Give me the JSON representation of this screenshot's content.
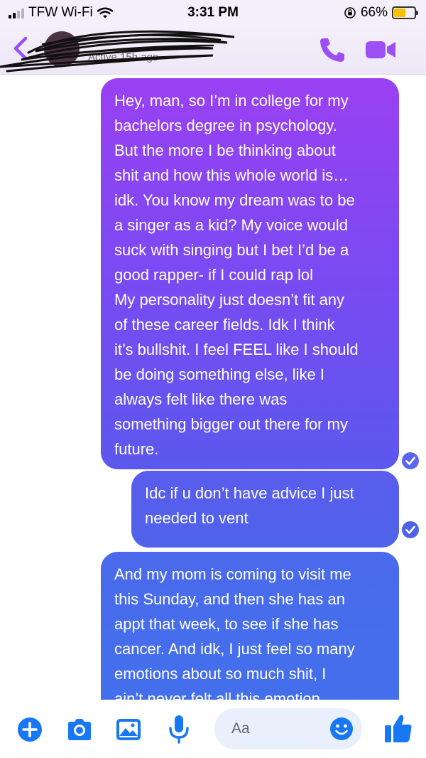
{
  "status_bar": {
    "carrier": "TFW Wi-Fi",
    "time": "3:31 PM",
    "battery_percent": "66%",
    "battery_level": 0.66,
    "signal_bars": 2
  },
  "header": {
    "contact_name": "",
    "active_status": "Active 15h ago",
    "icons": {
      "back": "chevron-left-icon",
      "call": "phone-icon",
      "video": "video-camera-icon"
    },
    "accent_color": "#9b4ff5"
  },
  "messages": [
    {
      "sender": "me",
      "text": "Hey, man, so I’m in college for my\nbachelors degree in psychology.\nBut the more I be thinking about\nshit and how this whole world is…\nidk. You know my dream was to be\na singer as a kid? My voice would\nsuck with singing but I bet I’d be a\ngood rapper- if I could rap lol\nMy personality just doesn’t fit any\nof these career fields. Idk I think\nit’s bullshit. I feel FEEL like I should\nbe doing something else, like I\nalways felt like there was\nsomething bigger out there for my\nfuture."
    },
    {
      "sender": "me",
      "text": "Idc if u don’t have advice I just\nneeded to vent"
    },
    {
      "sender": "me",
      "text": "And my mom is coming to visit me\nthis Sunday, and then she has an\nappt that week, to see if she has\ncancer. And idk, I just feel so many\nemotions about so much shit, I\nain’t never felt all this emotion"
    }
  ],
  "composer": {
    "placeholder": "Aa",
    "icons": [
      "plus-icon",
      "camera-icon",
      "photo-icon",
      "microphone-icon",
      "emoji-icon",
      "thumbs-up-icon"
    ],
    "accent_color": "#1877f2"
  }
}
